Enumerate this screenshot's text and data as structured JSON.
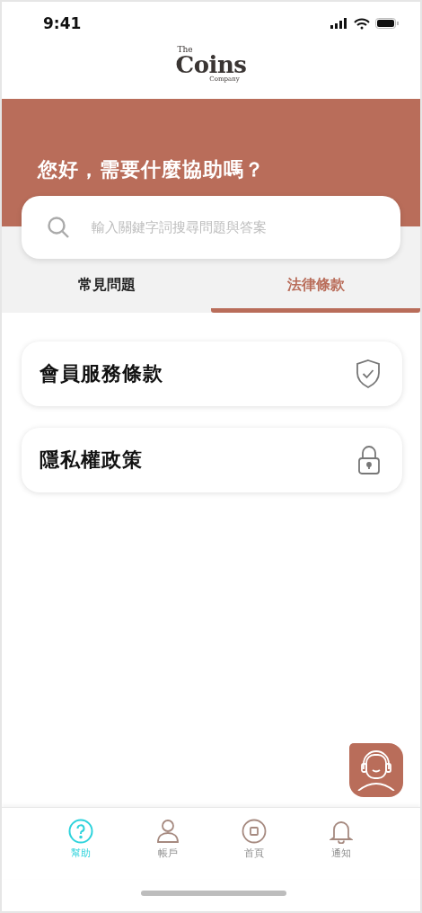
{
  "status_bar": {
    "time": "9:41"
  },
  "logo": {
    "top": "The",
    "main": "Coins",
    "bottom": "Company"
  },
  "banner": {
    "greeting": "您好，需要什麼協助嗎？"
  },
  "search": {
    "placeholder": "輸入關鍵字詞搜尋問題與答案"
  },
  "tabs": [
    {
      "label": "常見問題",
      "selected": false
    },
    {
      "label": "法律條款",
      "selected": true
    }
  ],
  "items": [
    {
      "label": "會員服務條款",
      "kind": "shield"
    },
    {
      "label": "隱私權政策",
      "kind": "lock"
    }
  ],
  "nav": [
    {
      "label": "幫助",
      "kind": "help",
      "selected": true
    },
    {
      "label": "帳戶",
      "kind": "account",
      "selected": false
    },
    {
      "label": "首頁",
      "kind": "home",
      "selected": false
    },
    {
      "label": "通知",
      "kind": "bell",
      "selected": false
    }
  ]
}
